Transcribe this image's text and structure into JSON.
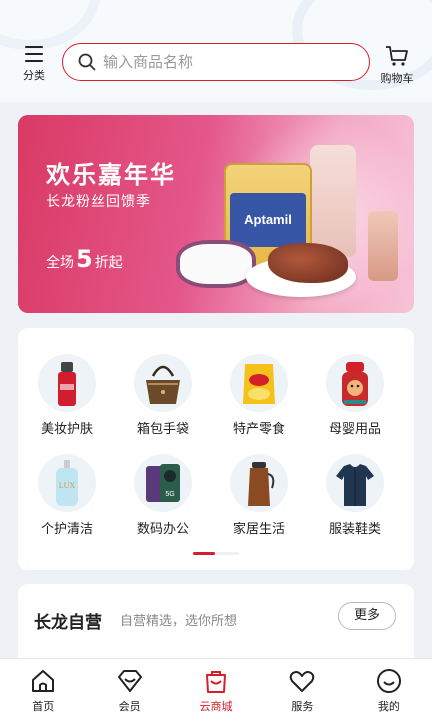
{
  "header": {
    "category_label": "分类",
    "search_placeholder": "输入商品名称",
    "cart_label": "购物车"
  },
  "banner": {
    "title": "欢乐嘉年华",
    "subtitle": "长龙粉丝回馈季",
    "promo_prefix": "全场",
    "promo_number": "5",
    "promo_suffix": "折起",
    "product_text": "Aptamil",
    "active_slide": 1,
    "slide_count": 3
  },
  "categories": [
    {
      "label": "美妆护肤",
      "icon": "skincare-bottle-icon"
    },
    {
      "label": "箱包手袋",
      "icon": "handbag-icon"
    },
    {
      "label": "特产零食",
      "icon": "snack-bag-icon"
    },
    {
      "label": "母婴用品",
      "icon": "baby-bottle-icon"
    },
    {
      "label": "个护清洁",
      "icon": "body-wash-icon"
    },
    {
      "label": "数码办公",
      "icon": "smartphone-icon"
    },
    {
      "label": "家居生活",
      "icon": "thermos-icon"
    },
    {
      "label": "服装鞋类",
      "icon": "shirt-icon"
    }
  ],
  "section": {
    "title": "长龙自营",
    "subtitle": "自营精选，选你所想",
    "more_label": "更多"
  },
  "tabbar": [
    {
      "label": "首页",
      "icon": "home-icon",
      "active": false
    },
    {
      "label": "会员",
      "icon": "member-diamond-icon",
      "active": false
    },
    {
      "label": "云商城",
      "icon": "shopping-bag-icon",
      "active": true
    },
    {
      "label": "服务",
      "icon": "heart-icon",
      "active": false
    },
    {
      "label": "我的",
      "icon": "profile-smile-icon",
      "active": false
    }
  ],
  "colors": {
    "accent": "#d4202a",
    "banner_start": "#d93a64",
    "banner_end": "#f7c3d5"
  }
}
